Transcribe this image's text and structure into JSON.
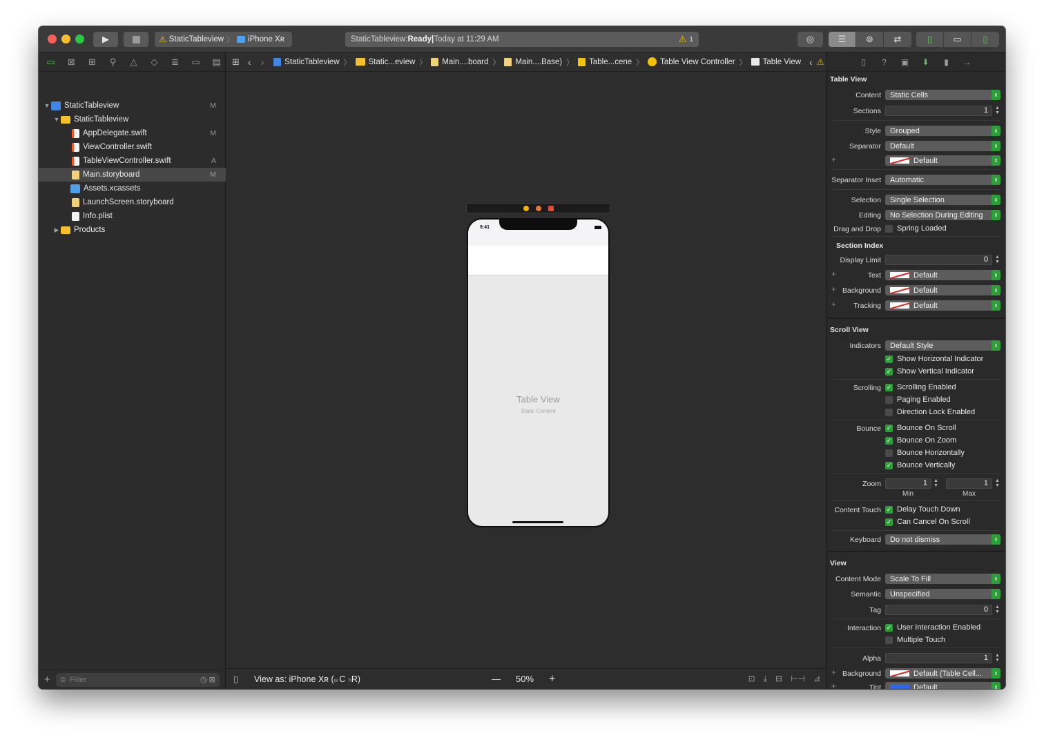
{
  "toolbar": {
    "scheme_target": "StaticTableview",
    "scheme_device": "iPhone Xʀ",
    "status_project": "StaticTableview: ",
    "status_state": "Ready",
    "status_separator": " | ",
    "status_time": "Today at 11:29 AM",
    "warning_count": "1"
  },
  "navigator": {
    "filter_placeholder": "Filter",
    "items": [
      {
        "label": "StaticTableview",
        "badge": "M"
      },
      {
        "label": "StaticTableview",
        "badge": ""
      },
      {
        "label": "AppDelegate.swift",
        "badge": "M"
      },
      {
        "label": "ViewController.swift",
        "badge": ""
      },
      {
        "label": "TableViewController.swift",
        "badge": "A"
      },
      {
        "label": "Main.storyboard",
        "badge": "M"
      },
      {
        "label": "Assets.xcassets",
        "badge": ""
      },
      {
        "label": "LaunchScreen.storyboard",
        "badge": ""
      },
      {
        "label": "Info.plist",
        "badge": ""
      },
      {
        "label": "Products",
        "badge": ""
      }
    ]
  },
  "jumpbar": {
    "crumbs": [
      "StaticTableview",
      "Static...eview",
      "Main....board",
      "Main....Base)",
      "Table...cene",
      "Table View Controller",
      "Table View"
    ]
  },
  "canvas": {
    "status_time": "9:41",
    "table_title": "Table View",
    "table_subtitle": "Static Content"
  },
  "editor_footer": {
    "view_as": "View as: iPhone Xʀ (",
    "size_class_w": "w",
    "size_class_c": "C",
    "size_class_h": "h",
    "size_class_r": "R)",
    "zoom_minus": "—",
    "zoom_level": "50%",
    "zoom_plus": "+"
  },
  "inspector": {
    "table_view": {
      "title": "Table View",
      "content_label": "Content",
      "content_value": "Static Cells",
      "sections_label": "Sections",
      "sections_value": "1",
      "style_label": "Style",
      "style_value": "Grouped",
      "separator_label": "Separator",
      "separator_value": "Default",
      "separator_color": "Default",
      "separator_inset_label": "Separator Inset",
      "separator_inset_value": "Automatic",
      "selection_label": "Selection",
      "selection_value": "Single Selection",
      "editing_label": "Editing",
      "editing_value": "No Selection During Editing",
      "drag_drop_label": "Drag and Drop",
      "spring_loaded": "Spring Loaded"
    },
    "section_index": {
      "title": "Section Index",
      "display_limit_label": "Display Limit",
      "display_limit_value": "0",
      "text_label": "Text",
      "text_value": "Default",
      "background_label": "Background",
      "background_value": "Default",
      "tracking_label": "Tracking",
      "tracking_value": "Default"
    },
    "scroll_view": {
      "title": "Scroll View",
      "indicators_label": "Indicators",
      "indicators_value": "Default Style",
      "show_horizontal": "Show Horizontal Indicator",
      "show_vertical": "Show Vertical Indicator",
      "scrolling_label": "Scrolling",
      "scrolling_enabled": "Scrolling Enabled",
      "paging_enabled": "Paging Enabled",
      "direction_lock": "Direction Lock Enabled",
      "bounce_label": "Bounce",
      "bounce_on_scroll": "Bounce On Scroll",
      "bounce_on_zoom": "Bounce On Zoom",
      "bounce_horizontally": "Bounce Horizontally",
      "bounce_vertically": "Bounce Vertically",
      "zoom_label": "Zoom",
      "zoom_min": "1",
      "zoom_max": "1",
      "min_label": "Min",
      "max_label": "Max",
      "content_touch_label": "Content Touch",
      "delay_touch_down": "Delay Touch Down",
      "can_cancel_on_scroll": "Can Cancel On Scroll",
      "keyboard_label": "Keyboard",
      "keyboard_value": "Do not dismiss"
    },
    "view": {
      "title": "View",
      "content_mode_label": "Content Mode",
      "content_mode_value": "Scale To Fill",
      "semantic_label": "Semantic",
      "semantic_value": "Unspecified",
      "tag_label": "Tag",
      "tag_value": "0",
      "interaction_label": "Interaction",
      "user_interaction": "User Interaction Enabled",
      "multiple_touch": "Multiple Touch",
      "alpha_label": "Alpha",
      "alpha_value": "1",
      "background_label": "Background",
      "background_value": "Default (Table Cell...",
      "tint_label": "Tint",
      "tint_value": "Default"
    }
  },
  "colors": {
    "accent_green": "#2e9e3a",
    "traffic_red": "#fe5f57",
    "traffic_yellow": "#febc2e",
    "traffic_green": "#28c840",
    "warning_yellow": "#f5c400"
  }
}
